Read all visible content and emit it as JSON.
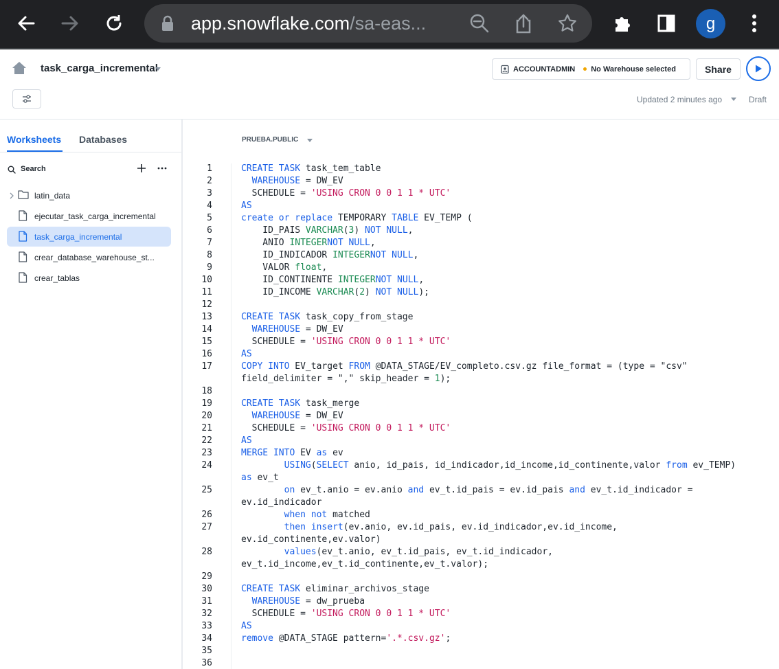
{
  "browser": {
    "url_main": "app.snowflake.com",
    "url_rest": "/sa-eas..."
  },
  "header": {
    "worksheet_title": "task_carga_incremental",
    "role": "ACCOUNTADMIN",
    "warehouse": "No Warehouse selected",
    "share_label": "Share",
    "updated": "Updated 2 minutes ago",
    "status": "Draft",
    "avatar_initial": "g"
  },
  "sidebar": {
    "tabs": [
      "Worksheets",
      "Databases"
    ],
    "active_tab": "Worksheets",
    "search_label": "Search",
    "items": [
      {
        "label": "latin_data",
        "type": "folder"
      },
      {
        "label": "ejecutar_task_carga_incremental",
        "type": "file"
      },
      {
        "label": "task_carga_incremental",
        "type": "file",
        "selected": true
      },
      {
        "label": "crear_database_warehouse_st...",
        "type": "file"
      },
      {
        "label": "crear_tablas",
        "type": "file"
      }
    ]
  },
  "editor": {
    "schema": "PRUEBA.PUBLIC",
    "lines": [
      {
        "n": "1",
        "tokens": [
          [
            "kw",
            "CREATE TASK"
          ],
          [
            "",
            "task_tem_table"
          ]
        ]
      },
      {
        "n": "2",
        "tokens": [
          [
            "",
            "  "
          ],
          [
            "kw",
            "WAREHOUSE"
          ],
          [
            "",
            "",
            " = DW_EV"
          ]
        ]
      },
      {
        "n": "3",
        "tokens": [
          [
            "",
            "  SCHEDULE = "
          ],
          [
            "str",
            "'USING CRON 0 0 1 1 * UTC'"
          ]
        ]
      },
      {
        "n": "4",
        "tokens": [
          [
            "kw",
            "AS"
          ]
        ]
      },
      {
        "n": "5",
        "tokens": [
          [
            "kw",
            "create or replace"
          ],
          [
            "",
            "TEMPORARY "
          ],
          [
            "kw",
            "TABLE"
          ],
          [
            "",
            "EV_TEMP ("
          ]
        ]
      },
      {
        "n": "6",
        "tokens": [
          [
            "",
            "    ID_PAIS "
          ],
          [
            "ty",
            "VARCHAR"
          ],
          [
            "",
            "("
          ],
          [
            "ty",
            "3"
          ],
          [
            "",
            ") "
          ],
          [
            "kw",
            "NOT NULL"
          ],
          [
            "",
            ","
          ]
        ]
      },
      {
        "n": "7",
        "tokens": [
          [
            "",
            "    ANIO "
          ],
          [
            "ty",
            "INTEGER"
          ],
          [
            "kw",
            "NOT NULL"
          ],
          [
            "",
            ","
          ]
        ]
      },
      {
        "n": "8",
        "tokens": [
          [
            "",
            "    ID_INDICADOR "
          ],
          [
            "ty",
            "INTEGER"
          ],
          [
            "kw",
            "NOT NULL"
          ],
          [
            "",
            ","
          ]
        ]
      },
      {
        "n": "9",
        "tokens": [
          [
            "",
            "    VALOR "
          ],
          [
            "ty",
            "float"
          ],
          [
            "",
            ","
          ]
        ]
      },
      {
        "n": "10",
        "tokens": [
          [
            "",
            "    ID_CONTINENTE "
          ],
          [
            "ty",
            "INTEGER"
          ],
          [
            "kw",
            "NOT NULL"
          ],
          [
            "",
            ","
          ]
        ]
      },
      {
        "n": "11",
        "tokens": [
          [
            "",
            "    ID_INCOME "
          ],
          [
            "ty",
            "VARCHAR"
          ],
          [
            "",
            "("
          ],
          [
            "ty",
            "2"
          ],
          [
            "",
            ") "
          ],
          [
            "kw",
            "NOT NULL"
          ],
          [
            "",
            ");"
          ]
        ]
      },
      {
        "n": "12",
        "tokens": []
      },
      {
        "n": "13",
        "tokens": [
          [
            "kw",
            "CREATE TASK"
          ],
          [
            "",
            "task_copy_from_stage"
          ]
        ]
      },
      {
        "n": "14",
        "tokens": [
          [
            "",
            "  "
          ],
          [
            "kw",
            "WAREHOUSE"
          ],
          [
            "",
            "",
            " = DW_EV"
          ]
        ]
      },
      {
        "n": "15",
        "tokens": [
          [
            "",
            "  SCHEDULE = "
          ],
          [
            "str",
            "'USING CRON 0 0 1 1 * UTC'"
          ]
        ]
      },
      {
        "n": "16",
        "tokens": [
          [
            "kw",
            "AS"
          ]
        ]
      },
      {
        "n": "17",
        "tokens": [
          [
            "kw",
            "COPY INTO"
          ],
          [
            "",
            "EV_target "
          ],
          [
            "kw",
            "FROM"
          ],
          [
            "",
            "@DATA_STAGE/EV_completo.csv.gz file_format = (type = \"csv\""
          ]
        ]
      },
      {
        "n": "",
        "tokens": [
          [
            "",
            "field_delimiter = \",\" skip_header = "
          ],
          [
            "ty",
            "1"
          ],
          [
            "",
            ");"
          ]
        ]
      },
      {
        "n": "18",
        "tokens": []
      },
      {
        "n": "19",
        "tokens": [
          [
            "kw",
            "CREATE TASK"
          ],
          [
            "",
            "task_merge"
          ]
        ]
      },
      {
        "n": "20",
        "tokens": [
          [
            "",
            "  "
          ],
          [
            "kw",
            "WAREHOUSE"
          ],
          [
            "",
            "",
            " = DW_EV"
          ]
        ]
      },
      {
        "n": "21",
        "tokens": [
          [
            "",
            "  SCHEDULE = "
          ],
          [
            "str",
            "'USING CRON 0 0 1 1 * UTC'"
          ]
        ]
      },
      {
        "n": "22",
        "tokens": [
          [
            "kw",
            "AS"
          ]
        ]
      },
      {
        "n": "23",
        "tokens": [
          [
            "kw",
            "MERGE INTO"
          ],
          [
            "",
            "EV "
          ],
          [
            "kw",
            "as"
          ],
          [
            "",
            "ev"
          ]
        ]
      },
      {
        "n": "24",
        "tokens": [
          [
            "",
            "        "
          ],
          [
            "kw",
            "USING"
          ],
          [
            "",
            "("
          ],
          [
            "kw",
            "SELECT"
          ],
          [
            "",
            "anio, id_pais, id_indicador,id_income,id_continente,valor "
          ],
          [
            "kw",
            "from"
          ],
          [
            "",
            "ev_TEMP)"
          ]
        ]
      },
      {
        "n": "",
        "tokens": [
          [
            "kw",
            "as"
          ],
          [
            "",
            "ev_t"
          ]
        ]
      },
      {
        "n": "25",
        "tokens": [
          [
            "",
            "        "
          ],
          [
            "kw",
            "on"
          ],
          [
            "",
            "ev_t.anio = ev.anio "
          ],
          [
            "kw",
            "and"
          ],
          [
            "",
            "ev_t.id_pais = ev.id_pais "
          ],
          [
            "kw",
            "and"
          ],
          [
            "",
            "ev_t.id_indicador ="
          ]
        ]
      },
      {
        "n": "",
        "tokens": [
          [
            "",
            "ev.id_indicador"
          ]
        ]
      },
      {
        "n": "26",
        "tokens": [
          [
            "",
            "        "
          ],
          [
            "kw",
            "when not"
          ],
          [
            "",
            "matched"
          ]
        ]
      },
      {
        "n": "27",
        "tokens": [
          [
            "",
            "        "
          ],
          [
            "kw",
            "then insert"
          ],
          [
            "",
            "(ev.anio, ev.id_pais, ev.id_indicador,ev.id_income,"
          ]
        ]
      },
      {
        "n": "",
        "tokens": [
          [
            "",
            "ev.id_continente,ev.valor)"
          ]
        ]
      },
      {
        "n": "28",
        "tokens": [
          [
            "",
            "        "
          ],
          [
            "kw",
            "values"
          ],
          [
            "",
            "(ev_t.anio, ev_t.id_pais, ev_t.id_indicador,"
          ]
        ]
      },
      {
        "n": "",
        "tokens": [
          [
            "",
            "ev_t.id_income,ev_t.id_continente,ev_t.valor);"
          ]
        ]
      },
      {
        "n": "29",
        "tokens": []
      },
      {
        "n": "30",
        "tokens": [
          [
            "kw",
            "CREATE TASK"
          ],
          [
            "",
            "eliminar_archivos_stage"
          ]
        ]
      },
      {
        "n": "31",
        "tokens": [
          [
            "",
            "  "
          ],
          [
            "kw",
            "WAREHOUSE"
          ],
          [
            "",
            "",
            " = dw_prueba"
          ]
        ]
      },
      {
        "n": "32",
        "tokens": [
          [
            "",
            "  SCHEDULE = "
          ],
          [
            "str",
            "'USING CRON 0 0 1 1 * UTC'"
          ]
        ]
      },
      {
        "n": "33",
        "tokens": [
          [
            "kw",
            "AS"
          ]
        ]
      },
      {
        "n": "34",
        "tokens": [
          [
            "kw",
            "remove"
          ],
          [
            "",
            "@DATA_STAGE pattern="
          ],
          [
            "str",
            "'.*.csv.gz'"
          ],
          [
            "",
            ";"
          ]
        ]
      },
      {
        "n": "35",
        "tokens": []
      },
      {
        "n": "36",
        "tokens": []
      }
    ]
  }
}
